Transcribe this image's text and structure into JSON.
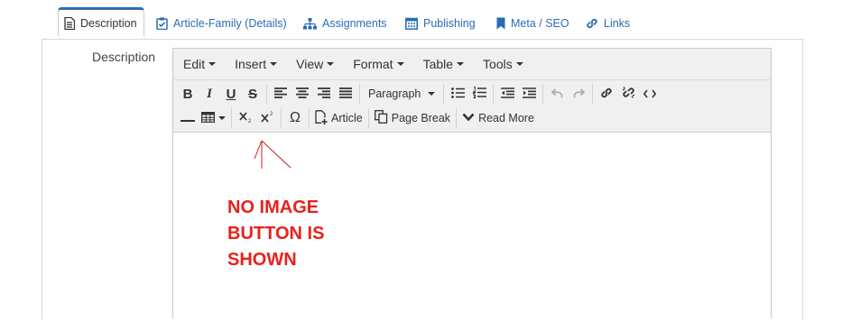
{
  "tabs": [
    {
      "label": "Description",
      "icon": "document-icon",
      "active": true
    },
    {
      "label": "Article-Family (Details)",
      "icon": "clipboard-check-icon"
    },
    {
      "label": "Assignments",
      "icon": "sitemap-icon"
    },
    {
      "label": "Publishing",
      "icon": "calendar-icon"
    },
    {
      "label": "Meta / SEO",
      "icon": "bookmark-icon"
    },
    {
      "label": "Links",
      "icon": "link-icon"
    }
  ],
  "field": {
    "label": "Description"
  },
  "menubar": [
    "Edit",
    "Insert",
    "View",
    "Format",
    "Table",
    "Tools"
  ],
  "toolbar": {
    "paragraph_select": "Paragraph",
    "article_label": "Article",
    "page_break_label": "Page Break",
    "read_more_label": "Read More",
    "bold": "B",
    "italic": "I",
    "underline": "U",
    "strike": "S",
    "omega": "Ω"
  },
  "annotation": {
    "lines": [
      "NO IMAGE",
      "BUTTON IS",
      "SHOWN"
    ],
    "color": "#e8211c"
  },
  "colors": {
    "accent": "#2a6db5",
    "toolbar_bg": "#f0f0f0"
  }
}
